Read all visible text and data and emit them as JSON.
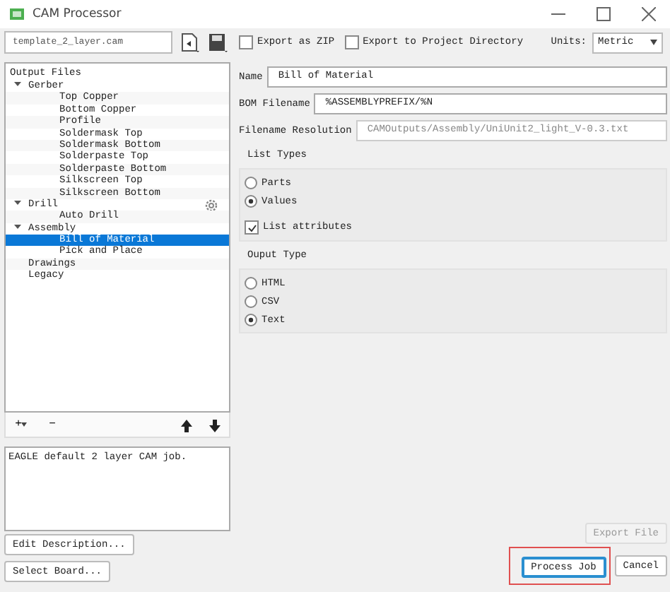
{
  "window": {
    "title": "CAM Processor"
  },
  "toolbar": {
    "job_file": "template_2_layer.cam",
    "export_zip": {
      "label": "Export as ZIP",
      "checked": false
    },
    "export_project": {
      "label": "Export to Project Directory",
      "checked": false
    },
    "units_label": "Units:",
    "units_value": "Metric"
  },
  "tree": {
    "header": "Output Files",
    "items": [
      {
        "label": "Gerber",
        "expanded": true,
        "selected": false,
        "children": [
          {
            "label": "Top Copper",
            "selected": false
          },
          {
            "label": "Bottom Copper",
            "selected": false
          },
          {
            "label": "Profile",
            "selected": false
          },
          {
            "label": "Soldermask Top",
            "selected": false
          },
          {
            "label": "Soldermask Bottom",
            "selected": false
          },
          {
            "label": "Solderpaste Top",
            "selected": false
          },
          {
            "label": "Solderpaste Bottom",
            "selected": false
          },
          {
            "label": "Silkscreen Top",
            "selected": false
          },
          {
            "label": "Silkscreen Bottom",
            "selected": false
          }
        ]
      },
      {
        "label": "Drill",
        "expanded": true,
        "selected": false,
        "settings": true,
        "children": [
          {
            "label": "Auto Drill",
            "selected": false
          }
        ]
      },
      {
        "label": "Assembly",
        "expanded": true,
        "selected": false,
        "children": [
          {
            "label": "Bill of Material",
            "selected": true
          },
          {
            "label": "Pick and Place",
            "selected": false
          }
        ]
      },
      {
        "label": "Drawings",
        "selected": false
      },
      {
        "label": "Legacy",
        "selected": false
      }
    ]
  },
  "tree_buttons": [
    {
      "label": "+",
      "menu": true
    },
    {
      "label": "−",
      "menu": false
    }
  ],
  "description": "EAGLE default 2 layer CAM job.",
  "left_buttons": [
    "Edit Description...",
    "Select Board..."
  ],
  "form": {
    "fields": [
      {
        "label": "Name",
        "value": "Bill of Material",
        "disabled": false
      },
      {
        "label": "BOM Filename",
        "value": "%ASSEMBLYPREFIX/%N",
        "disabled": false
      },
      {
        "label": "Filename Resolution",
        "value": "CAMOutputs/Assembly/UniUnit2_light_V-0.3.txt",
        "disabled": true
      }
    ],
    "groups": [
      {
        "title": "List Types",
        "options": [
          {
            "kind": "radio",
            "label": "Parts",
            "selected": false
          },
          {
            "kind": "radio",
            "label": "Values",
            "selected": true
          },
          {
            "kind": "checkbox",
            "label": "List attributes",
            "checked": true
          }
        ]
      },
      {
        "title": "Ouput Type",
        "options": [
          {
            "kind": "radio",
            "label": "HTML",
            "selected": false
          },
          {
            "kind": "radio",
            "label": "CSV",
            "selected": false
          },
          {
            "kind": "radio",
            "label": "Text",
            "selected": true
          }
        ]
      }
    ]
  },
  "export_button": {
    "label": "Export File",
    "disabled": true
  },
  "footer_buttons": [
    {
      "label": "Process Job",
      "highlighted": true,
      "default": true
    },
    {
      "label": "Cancel",
      "highlighted": false,
      "default": false
    }
  ]
}
